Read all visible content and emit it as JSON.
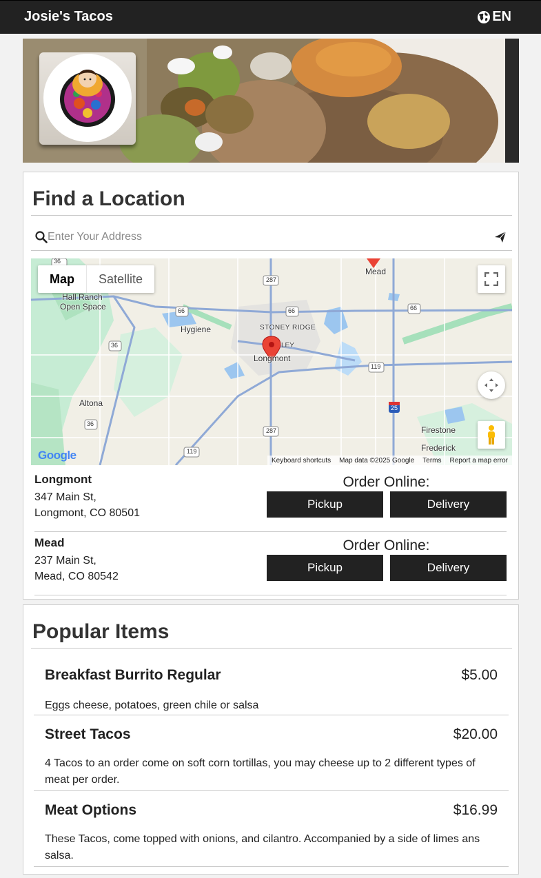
{
  "header": {
    "brand": "Josie's Tacos",
    "language": "EN"
  },
  "find_location": {
    "title": "Find a Location",
    "search_placeholder": "Enter Your Address",
    "map": {
      "type_map": "Map",
      "type_satellite": "Satellite",
      "labels": {
        "mead": "Mead",
        "hall_ranch": "Hall Ranch",
        "open_space": "Open Space",
        "hygiene": "Hygiene",
        "stoney_ridge": "STONEY RIDGE",
        "longmont": "Longmont",
        "altona": "Altona",
        "firestone": "Firestone",
        "frederick": "Frederick",
        "ley": "LEY"
      },
      "road_shields": [
        "36",
        "287",
        "66",
        "66",
        "66",
        "36",
        "119",
        "25",
        "36",
        "287",
        "119"
      ],
      "footer": {
        "shortcuts": "Keyboard shortcuts",
        "data": "Map data ©2025 Google",
        "terms": "Terms",
        "report": "Report a map error"
      },
      "google": "Google"
    },
    "order_label": "Order Online:",
    "pickup_label": "Pickup",
    "delivery_label": "Delivery",
    "locations": [
      {
        "name": "Longmont",
        "address1": "347 Main St,",
        "address2": "Longmont, CO 80501"
      },
      {
        "name": "Mead",
        "address1": "237 Main St,",
        "address2": "Mead, CO 80542"
      }
    ]
  },
  "popular": {
    "title": "Popular Items",
    "items": [
      {
        "name": "Breakfast Burrito Regular",
        "price": "$5.00",
        "description": "Eggs cheese, potatoes, green chile or salsa"
      },
      {
        "name": "Street Tacos",
        "price": "$20.00",
        "description": "4 Tacos to an order come on soft corn tortillas, you may cheese up to 2 different types of meat per order."
      },
      {
        "name": "Meat Options",
        "price": "$16.99",
        "description": "These Tacos, come topped with onions, and cilantro. Accompanied by a side of limes ans salsa."
      }
    ]
  },
  "colors": {
    "header_bg": "#222222",
    "button_bg": "#222222",
    "map_pin": "#ea4335"
  }
}
